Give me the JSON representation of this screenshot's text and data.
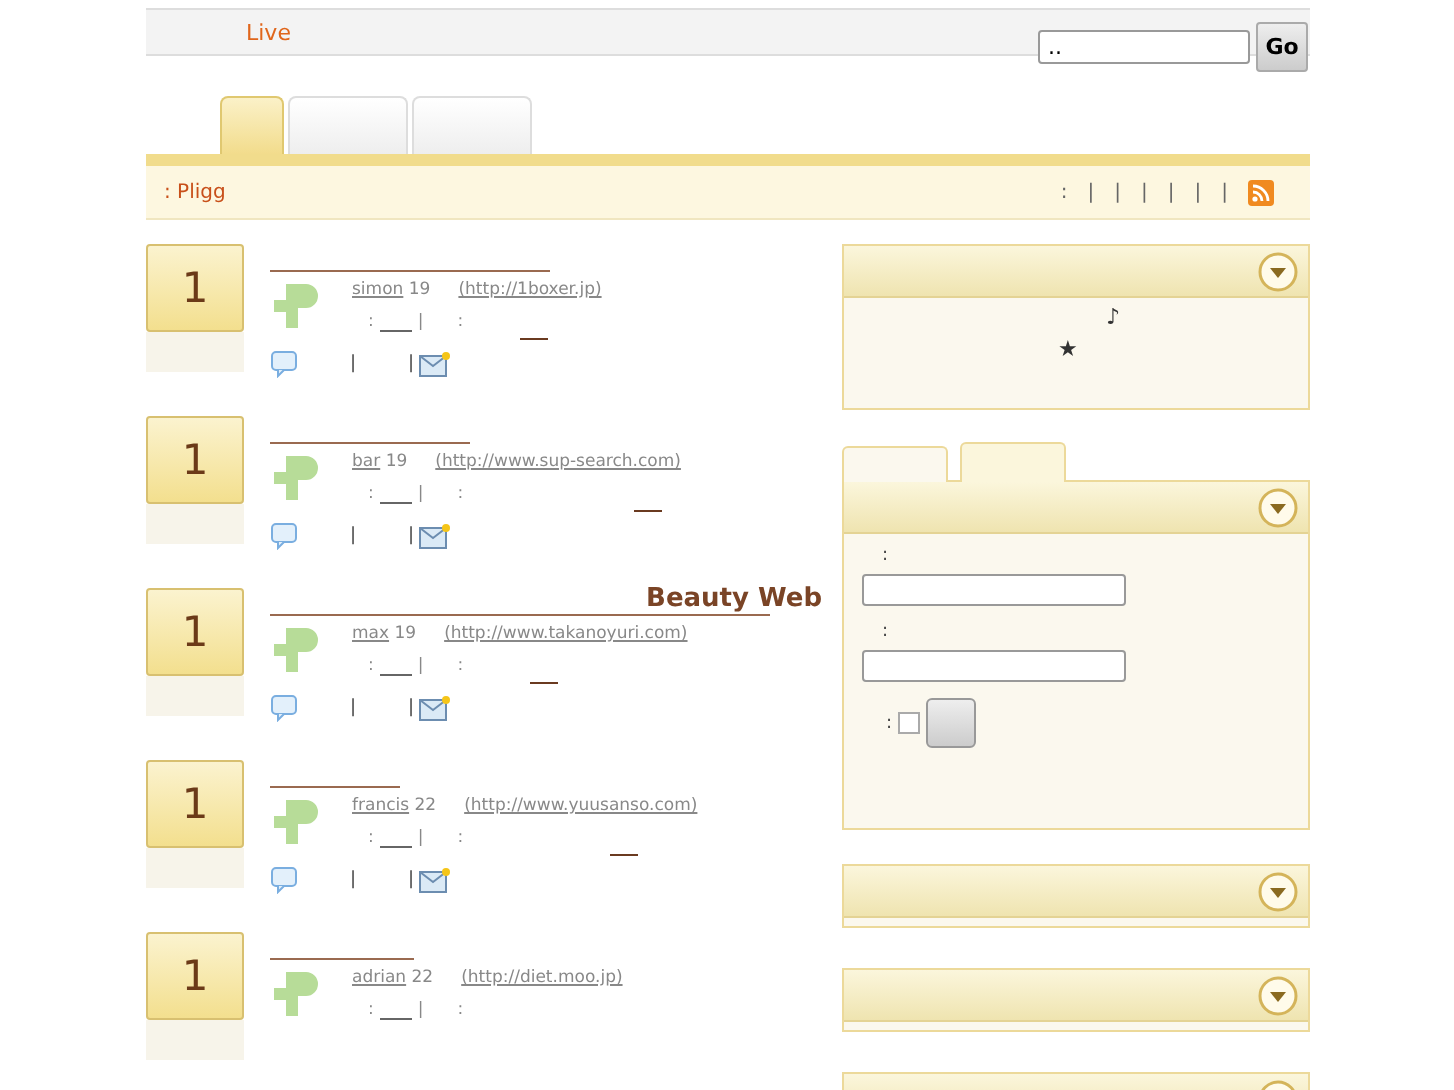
{
  "header": {
    "brand": "Live",
    "search": {
      "value": ".."
    },
    "go": "Go"
  },
  "tabs": [
    {
      "selected": true
    },
    {
      "selected": false
    },
    {
      "selected": false
    }
  ],
  "breadcrumb": {
    "text": ": Pligg",
    "marks": [
      ":",
      "|",
      "|",
      "|",
      "|",
      "|",
      "|"
    ]
  },
  "stories": [
    {
      "votes": "1",
      "user": "simon",
      "age": "19",
      "url": "(http://1boxer.jp)",
      "meta": [
        ":",
        "|",
        ":"
      ],
      "actions": [
        "|",
        "|"
      ]
    },
    {
      "votes": "1",
      "user": "bar",
      "age": "19",
      "url": "(http://www.sup-search.com)",
      "meta": [
        ":",
        "|",
        ":"
      ],
      "actions": [
        "|",
        "|"
      ]
    },
    {
      "votes": "1",
      "title": "Beauty Web",
      "user": "max",
      "age": "19",
      "url": "(http://www.takanoyuri.com)",
      "meta": [
        ":",
        "|",
        ":"
      ],
      "actions": [
        "|",
        "|"
      ]
    },
    {
      "votes": "1",
      "user": "francis",
      "age": "22",
      "url": "(http://www.yuusanso.com)",
      "meta": [
        ":",
        "|",
        ":"
      ],
      "actions": [
        "|",
        "|"
      ]
    },
    {
      "votes": "1",
      "user": "adrian",
      "age": "22",
      "url": "(http://diet.moo.jp)",
      "meta": [
        ":",
        "|",
        ":"
      ]
    }
  ],
  "sidebar": {
    "first_box": {
      "symbols": [
        "♪",
        "★"
      ]
    },
    "login_tabs": [
      {
        "selected": false
      },
      {
        "selected": true
      }
    ],
    "login": {
      "labels": [
        ":",
        ":"
      ],
      "remember_label": ":",
      "remember_checked": false
    }
  }
}
